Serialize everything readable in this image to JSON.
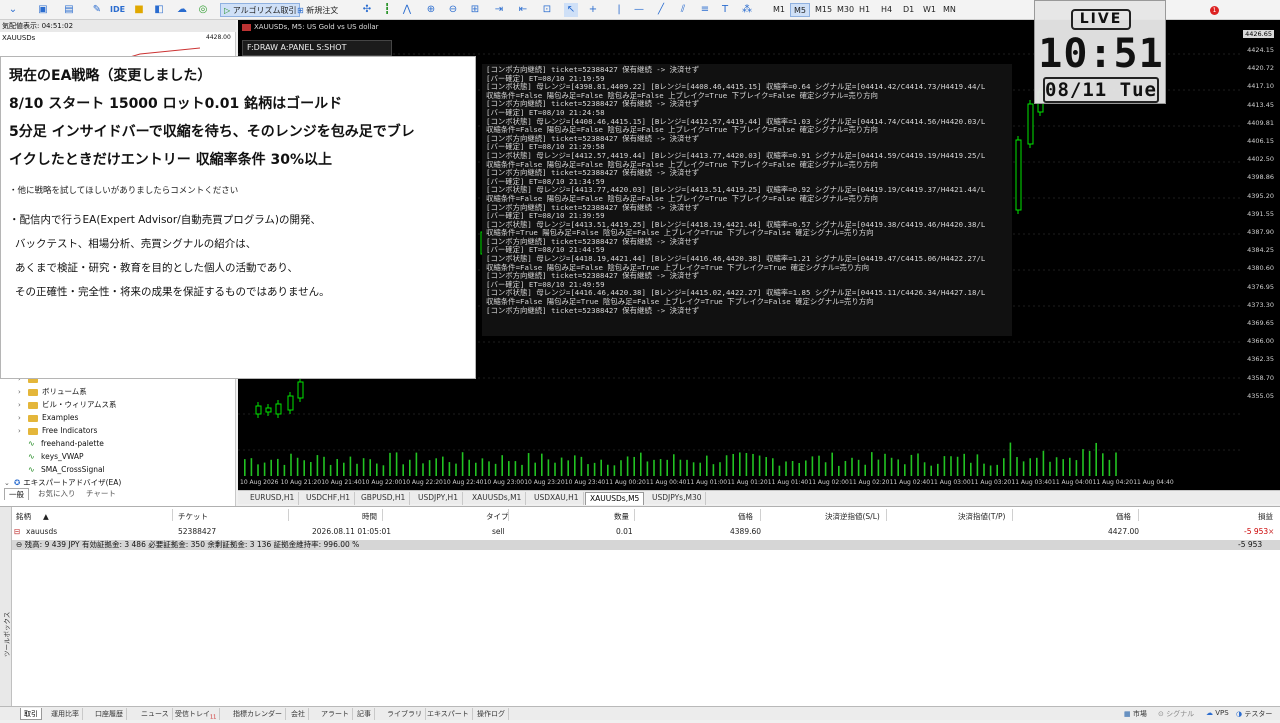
{
  "toolbar": {
    "ide_label": "IDE",
    "algo_label": "アルゴリズム取引",
    "new_order_label": "新規注文",
    "timeframes": [
      "M1",
      "M5",
      "M15",
      "M30",
      "H1",
      "H4",
      "D1",
      "W1",
      "MN"
    ],
    "active_timeframe": "M5",
    "notifications": "1"
  },
  "navigator": {
    "title": "気配値表示: 04:51:02",
    "mini_symbol": "XAUUSDs",
    "mini_price": "4428.00",
    "items": [
      {
        "type": "folder",
        "label": "ボリューム系"
      },
      {
        "type": "folder",
        "label": "ビル・ウィリアムス系"
      },
      {
        "type": "folder",
        "label": "Examples"
      },
      {
        "type": "folder",
        "label": "Free Indicators"
      },
      {
        "type": "indicator",
        "label": "freehand-palette"
      },
      {
        "type": "indicator",
        "label": "keys_VWAP"
      },
      {
        "type": "indicator",
        "label": "SMA_CrossSignal"
      },
      {
        "type": "root",
        "label": "エキスパートアドバイザ(EA)"
      }
    ],
    "tabs": [
      "一般",
      "お気に入り",
      "チャート"
    ]
  },
  "chart": {
    "title": "XAUUSDs, M5:  US Gold vs US dollar",
    "draw_panel": "F:DRAW   A:PANEL   S:SHOT",
    "current_price": "4426.65",
    "price_labels": [
      "4424.15",
      "4420.72",
      "4417.10",
      "4413.45",
      "4409.81",
      "4406.15",
      "4402.50",
      "4398.86",
      "4395.20",
      "4391.55",
      "4387.90",
      "4384.25",
      "4380.60",
      "4376.95",
      "4373.30",
      "4369.65",
      "4366.00",
      "4362.35",
      "4358.70",
      "4355.05"
    ],
    "time_labels": [
      "10 Aug 2026",
      "10 Aug 21:20",
      "10 Aug 21:40",
      "10 Aug 22:00",
      "10 Aug 22:20",
      "10 Aug 22:40",
      "10 Aug 23:00",
      "10 Aug 23:20",
      "10 Aug 23:40",
      "11 Aug 00:20",
      "11 Aug 00:40",
      "11 Aug 01:00",
      "11 Aug 01:20",
      "11 Aug 01:40",
      "11 Aug 02:00",
      "11 Aug 02:20",
      "11 Aug 02:40",
      "11 Aug 03:00",
      "11 Aug 03:20",
      "11 Aug 03:40",
      "11 Aug 04:00",
      "11 Aug 04:20",
      "11 Aug 04:40"
    ],
    "log_lines": [
      "[コンポ方向継続] ticket=52388427 保有継続 -> 決済せず",
      "[バー確定] ET=08/10 21:19:59",
      "[コンボ状態] 母レンジ=[4398.81,4409.22] [Bレンジ=[4408.46,4415.15] 収縮率=0.64 シグナル足=[04414.42/C4414.73/H4419.44/L",
      "  収縮条件=False 陽包み足=False 陰包み足=False 上ブレイク=True 下ブレイク=False 確定シグナル=売り方向",
      "[コンボ方向継続] ticket=52388427 保有継続 -> 決済せず",
      "[バー確定] ET=08/10 21:24:58",
      "[コンボ状態] 母レンジ=[4408.46,4415.15] [Bレンジ=[4412.57,4419.44] 収縮率=1.03 シグナル足=[04414.74/C4414.56/H4420.03/L",
      "  収縮条件=False 陽包み足=False 陰包み足=False 上ブレイク=True 下ブレイク=False 確定シグナル=売り方向",
      "[コンボ方向継続] ticket=52388427 保有継続 -> 決済せず",
      "[バー確定] ET=08/10 21:29:58",
      "[コンボ状態] 母レンジ=[4412.57,4419.44] [Bレンジ=[4413.77,4420.03] 収縮率=0.91 シグナル足=[04414.59/C4419.19/H4419.25/L",
      "  収縮条件=False 陽包み足=False 陰包み足=False 上ブレイク=True 下ブレイク=False 確定シグナル=売り方向",
      "[コンボ方向継続] ticket=52388427 保有継続 -> 決済せず",
      "[バー確定] ET=08/10 21:34:59",
      "[コンボ状態] 母レンジ=[4413.77,4420.03] [Bレンジ=[4413.51,4419.25] 収縮率=0.92 シグナル足=[04419.19/C4419.37/H4421.44/L",
      "  収縮条件=False 陽包み足=False 陰包み足=False 上ブレイク=True 下ブレイク=False 確定シグナル=売り方向",
      "[コンボ方向継続] ticket=52388427 保有継続 -> 決済せず",
      "[バー確定] ET=08/10 21:39:59",
      "[コンボ状態] 母レンジ=[4413.51,4419.25] [Bレンジ=[4418.19,4421.44] 収縮率=0.57 シグナル足=[04419.38/C4419.46/H4420.38/L",
      "  収縮条件=True 陽包み足=False 陰包み足=False 上ブレイク=True 下ブレイク=False 確定シグナル=売り方向",
      "[コンボ方向継続] ticket=52388427 保有継続 -> 決済せず",
      "[バー確定] ET=08/10 21:44:59",
      "[コンボ状態] 母レンジ=[4418.19,4421.44] [Bレンジ=[4416.46,4420.38] 収縮率=1.21 シグナル足=[04419.47/C4415.06/H4422.27/L",
      "  収縮条件=False 陽包み足=False 陰包み足=True 上ブレイク=True 下ブレイク=True 確定シグナル=売り方向",
      "[コンボ方向継続] ticket=52388427 保有継続 -> 決済せず",
      "[バー確定] ET=08/10 21:49:59",
      "[コンボ状態] 母レンジ=[4416.46,4420.38] [Bレンジ=[4415.02,4422.27] 収縮率=1.85 シグナル足=[04415.11/C4426.34/H4427.18/L",
      "  収縮条件=False 陽包み足=True 陰包み足=False 上ブレイク=True 下ブレイク=False 確定シグナル=売り方向",
      "[コンボ方向継続] ticket=52388427 保有継続 -> 決済せず"
    ]
  },
  "clock": {
    "live": "LIVE",
    "time": "10:51",
    "date": "08/11 Tue"
  },
  "overlay": {
    "heading": "現在のEA戦略（変更しました）",
    "line1": "8/10 スタート 15000 ロット0.01 銘柄はゴールド",
    "line2": "5分足 インサイドバーで収縮を待ち、そのレンジを包み足でブレ",
    "line3": "イクしたときだけエントリー 収縮率条件 30%以上",
    "note": "・他に戦略を試してほしいがありましたらコメントください",
    "disclaimer1": "・配信内で行うEA(Expert Advisor/自動売買プログラム)の開発、",
    "disclaimer2": "バックテスト、相場分析、売買シグナルの紹介は、",
    "disclaimer3": "あくまで検証・研究・教育を目的とした個人の活動であり、",
    "disclaimer4": "その正確性・完全性・将来の成果を保証するものではありません。"
  },
  "chart_tabs": [
    "EURUSD,H1",
    "USDCHF,H1",
    "GBPUSD,H1",
    "USDJPY,H1",
    "XAUUSDs,M1",
    "USDXAU,H1",
    "XAUUSDs,M5",
    "USDJPYs,M30"
  ],
  "active_chart_tab": "XAUUSDs,M5",
  "terminal": {
    "headers": {
      "symbol": "銘柄",
      "ticket": "チケット",
      "time": "時間",
      "type": "タイプ",
      "volume": "数量",
      "price": "価格",
      "sl": "決済逆指値(S/L)",
      "tp": "決済指値(T/P)",
      "cur_price": "価格",
      "profit": "損益"
    },
    "row": {
      "symbol": "xauusds",
      "ticket": "52388427",
      "time": "2026.08.11 01:05:01",
      "type": "sell",
      "volume": "0.01",
      "price": "4389.60",
      "sl": "",
      "tp": "",
      "cur_price": "4427.00",
      "profit": "-5 953"
    },
    "balance": "残高: 9 439 JPY  有効証拠金: 3 486  必要証拠金: 350  余剰証拠金: 3 136  証拠金維持率: 996.00 %",
    "total_profit": "-5 953",
    "side_label": "ツールボックス"
  },
  "bottom_tabs": [
    "取引",
    "運用比率",
    "口座履歴",
    "ニュース",
    "受信トレイ",
    "指標カレンダー",
    "会社",
    "アラート",
    "記事",
    "ライブラリ",
    "エキスパート",
    "操作ログ"
  ],
  "inbox_badge": "11",
  "status": {
    "market": "市場",
    "signal": "シグナル",
    "vps": "VPS",
    "tester": "テスター"
  },
  "colors": {
    "chart_bg": "#000000",
    "candle_up": "#00e600",
    "volume": "#22c322",
    "profit_negative": "#cc0000"
  }
}
